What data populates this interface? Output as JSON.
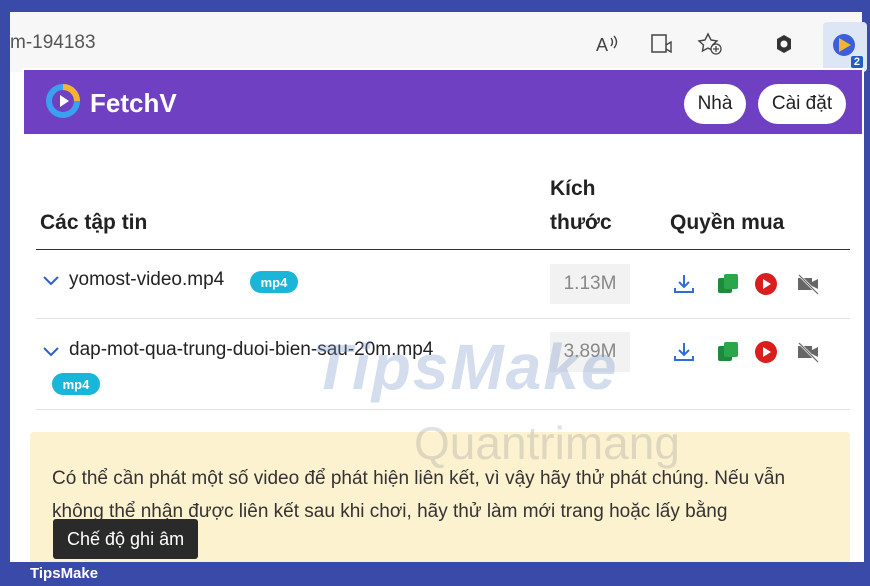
{
  "browser": {
    "url_fragment": "m-194183",
    "extension_badge": "2"
  },
  "app": {
    "brand": "FetchV",
    "nav": {
      "home_label": "Nhà",
      "settings_label": "Cài đặt"
    }
  },
  "table": {
    "headers": {
      "files": "Các tập tin",
      "size_line1": "Kích",
      "size_line2": "thước",
      "rights": "Quyền mua"
    },
    "rows": [
      {
        "name": "yomost-video.mp4",
        "format": "mp4",
        "size": "1.13M"
      },
      {
        "name": "dap-mot-qua-trung-duoi-bien-sau-20m.mp4",
        "format": "mp4",
        "size": "3.89M"
      }
    ]
  },
  "notice": {
    "text": "Có thể cần phát một số video để phát hiện liên kết, vì vậy hãy thử phát chúng. Nếu vẫn không thể nhận được liên kết sau khi chơi, hãy thử làm mới trang hoặc lấy bằng",
    "record_button": "Chế độ ghi âm"
  },
  "watermarks": {
    "primary": "TipsMake",
    "secondary": "Quantrimang"
  },
  "footer": {
    "label": "TipsMake"
  },
  "colors": {
    "header_bg": "#7040c2",
    "format_tag": "#1ab6d9",
    "download_icon": "#2d6fd6",
    "copy_icon": "#1e8a3c",
    "play_icon": "#d81e1e",
    "notice_bg": "#fdf2d0"
  }
}
